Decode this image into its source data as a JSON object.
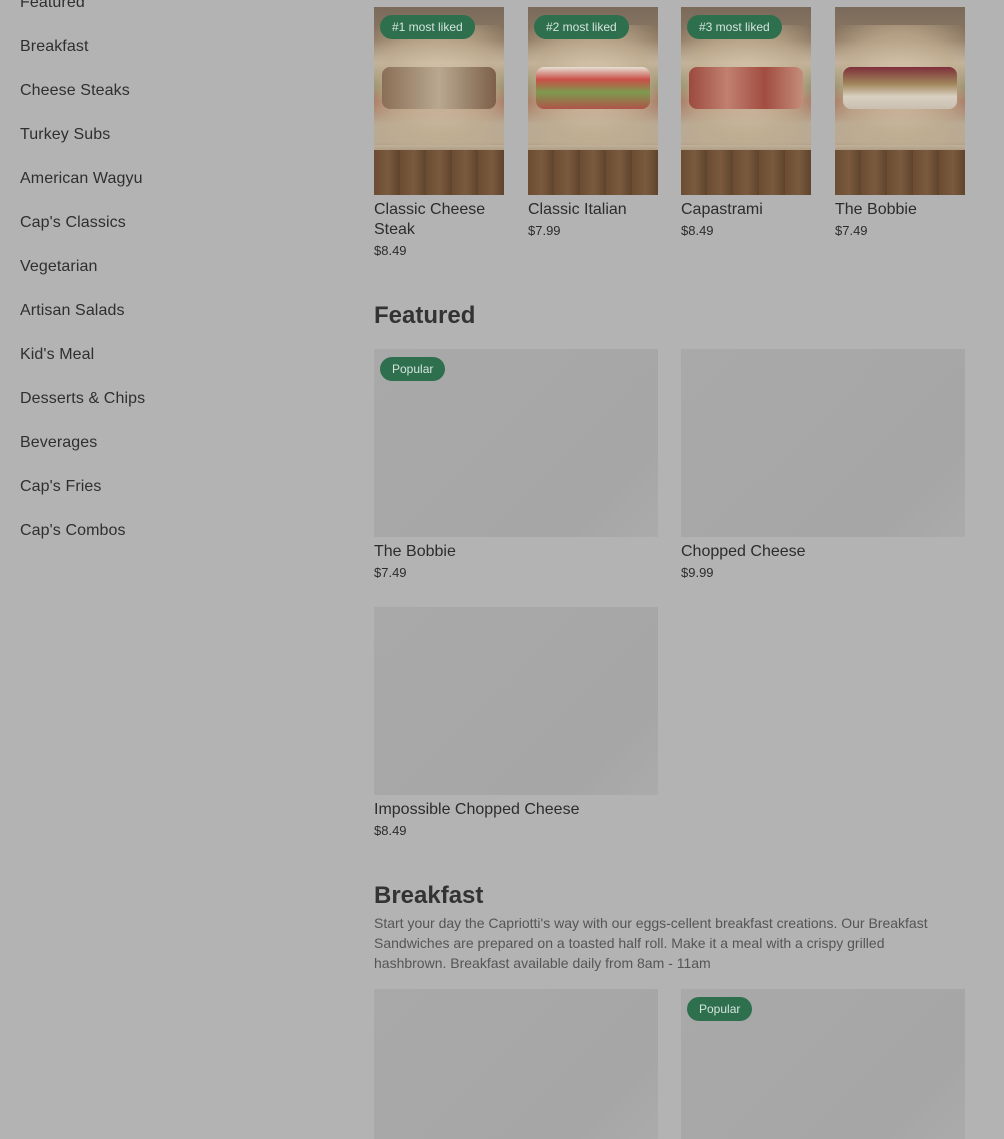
{
  "sidebar": {
    "items": [
      {
        "label": "Featured"
      },
      {
        "label": "Breakfast"
      },
      {
        "label": "Cheese Steaks"
      },
      {
        "label": "Turkey Subs"
      },
      {
        "label": "American Wagyu"
      },
      {
        "label": "Cap's Classics"
      },
      {
        "label": "Vegetarian"
      },
      {
        "label": "Artisan Salads"
      },
      {
        "label": "Kid's Meal"
      },
      {
        "label": "Desserts & Chips"
      },
      {
        "label": "Beverages"
      },
      {
        "label": "Cap's Fries"
      },
      {
        "label": "Cap's Combos"
      }
    ]
  },
  "most_liked": [
    {
      "badge": "#1 most liked",
      "name": "Classic Cheese Steak",
      "price": "$8.49"
    },
    {
      "badge": "#2 most liked",
      "name": "Classic Italian",
      "price": "$7.99"
    },
    {
      "badge": "#3 most liked",
      "name": "Capastrami",
      "price": "$8.49"
    },
    {
      "badge": "",
      "name": "The Bobbie",
      "price": "$7.49"
    }
  ],
  "featured": {
    "title": "Featured",
    "items": [
      {
        "badge": "Popular",
        "name": "The Bobbie",
        "price": "$7.49"
      },
      {
        "badge": "",
        "name": "Chopped Cheese",
        "price": "$9.99"
      },
      {
        "badge": "",
        "name": "Impossible Chopped Cheese",
        "price": "$8.49"
      }
    ]
  },
  "breakfast": {
    "title": "Breakfast",
    "description": "Start your day the Capriotti's way with our eggs-cellent breakfast creations. Our Breakfast Sandwiches are prepared on a toasted half roll. Make it a meal with a crispy grilled hashbrown. Breakfast available daily from 8am - 11am",
    "items": [
      {
        "badge": ""
      },
      {
        "badge": "Popular"
      }
    ]
  },
  "colors": {
    "overlay_bg": "#b3b3b3",
    "badge_bg": "#2e6f4e"
  }
}
